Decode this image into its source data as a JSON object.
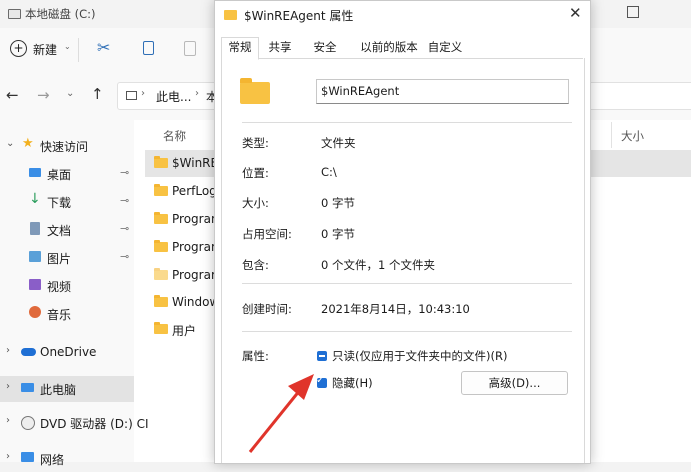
{
  "explorer": {
    "window_title": "本地磁盘 (C:)",
    "toolbar": {
      "new_label": "新建"
    },
    "address": {
      "crumb1": "此电...",
      "crumb2": "本"
    },
    "columns": {
      "name": "名称",
      "size": "大小"
    },
    "sidebar": {
      "items": [
        {
          "label": "快速访问",
          "icon": "star-icon"
        },
        {
          "label": "桌面",
          "icon": "desktop-icon"
        },
        {
          "label": "下载",
          "icon": "download-icon"
        },
        {
          "label": "文档",
          "icon": "document-icon"
        },
        {
          "label": "图片",
          "icon": "picture-icon"
        },
        {
          "label": "视频",
          "icon": "video-icon"
        },
        {
          "label": "音乐",
          "icon": "music-icon"
        },
        {
          "label": "OneDrive",
          "icon": "cloud-icon"
        },
        {
          "label": "此电脑",
          "icon": "computer-icon"
        },
        {
          "label": "DVD 驱动器 (D:) CI",
          "icon": "dvd-icon"
        },
        {
          "label": "网络",
          "icon": "network-icon"
        }
      ]
    },
    "files": [
      "$WinREA",
      "PerfLogs",
      "Program",
      "Program",
      "Program",
      "Windows",
      "用户"
    ]
  },
  "dialog": {
    "title": "$WinREAgent 属性",
    "tabs": [
      "常规",
      "共享",
      "安全",
      "以前的版本",
      "自定义"
    ],
    "name_value": "$WinREAgent",
    "props": {
      "type_label": "类型:",
      "type_value": "文件夹",
      "location_label": "位置:",
      "location_value": "C:\\",
      "size_label": "大小:",
      "size_value": "0 字节",
      "disk_label": "占用空间:",
      "disk_value": "0 字节",
      "contains_label": "包含:",
      "contains_value": "0 个文件，1 个文件夹",
      "created_label": "创建时间:",
      "created_value": "2021年8月14日，10:43:10",
      "attr_label": "属性:",
      "readonly_label": "只读(仅应用于文件夹中的文件)(R)",
      "hidden_label": "隐藏(H)",
      "advanced_label": "高级(D)..."
    }
  },
  "colors": {
    "accent": "#1f6fd4",
    "folder": "#f8c243",
    "arrow": "#e0342b"
  }
}
